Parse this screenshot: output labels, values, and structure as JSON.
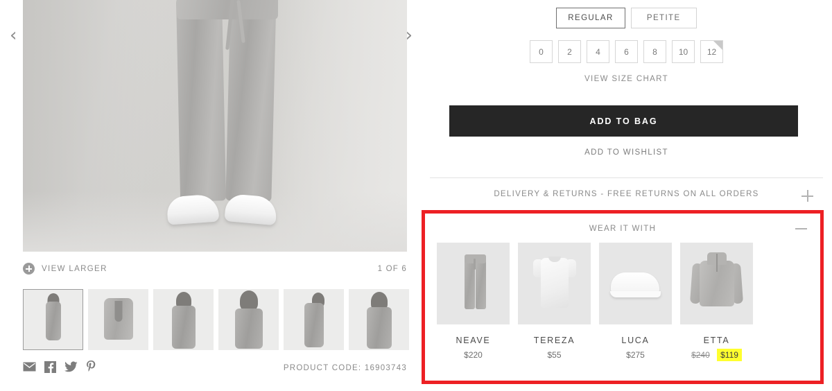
{
  "gallery": {
    "prev_arrow_icon": "chevron-left-icon",
    "next_arrow_icon": "chevron-right-icon",
    "view_larger_label": "VIEW LARGER",
    "image_counter": "1 OF 6",
    "thumbnails": [
      {
        "alt": "full outfit front view",
        "selected": true
      },
      {
        "alt": "blazer flat lay",
        "selected": false
      },
      {
        "alt": "model front close",
        "selected": false
      },
      {
        "alt": "model hood detail",
        "selected": false
      },
      {
        "alt": "model side view",
        "selected": false
      },
      {
        "alt": "model back view",
        "selected": false
      }
    ],
    "share": [
      {
        "icon": "email-icon",
        "label": "Email"
      },
      {
        "icon": "facebook-icon",
        "label": "Facebook"
      },
      {
        "icon": "twitter-icon",
        "label": "Twitter"
      },
      {
        "icon": "pinterest-icon",
        "label": "Pinterest"
      }
    ],
    "product_code": "PRODUCT CODE: 16903743"
  },
  "details": {
    "fit_options": [
      {
        "label": "REGULAR",
        "selected": true
      },
      {
        "label": "PETITE",
        "selected": false
      }
    ],
    "sizes": [
      {
        "label": "0",
        "low_stock": false
      },
      {
        "label": "2",
        "low_stock": false
      },
      {
        "label": "4",
        "low_stock": false
      },
      {
        "label": "6",
        "low_stock": false
      },
      {
        "label": "8",
        "low_stock": false
      },
      {
        "label": "10",
        "low_stock": false
      },
      {
        "label": "12",
        "low_stock": true
      }
    ],
    "size_chart_label": "VIEW SIZE CHART",
    "add_to_bag_label": "ADD TO BAG",
    "add_to_wishlist_label": "ADD TO WISHLIST",
    "delivery_accordion_label": "DELIVERY & RETURNS - FREE RETURNS ON ALL ORDERS",
    "delivery_accordion_icon": "plus-icon"
  },
  "wear_it_with": {
    "title": "WEAR IT WITH",
    "collapse_icon": "minus-icon",
    "highlight_color": "#ed2024",
    "sale_highlight_color": "#ffff2e",
    "items": [
      {
        "name": "NEAVE",
        "price": "$220",
        "was_price": "",
        "on_sale": false,
        "thumb": "grey-joggers"
      },
      {
        "name": "TEREZA",
        "price": "$55",
        "was_price": "",
        "on_sale": false,
        "thumb": "white-tee"
      },
      {
        "name": "LUCA",
        "price": "$275",
        "was_price": "",
        "on_sale": false,
        "thumb": "white-sneaker"
      },
      {
        "name": "ETTA",
        "price": "$119",
        "was_price": "$240",
        "on_sale": true,
        "thumb": "grey-half-zip-sweater"
      }
    ]
  }
}
